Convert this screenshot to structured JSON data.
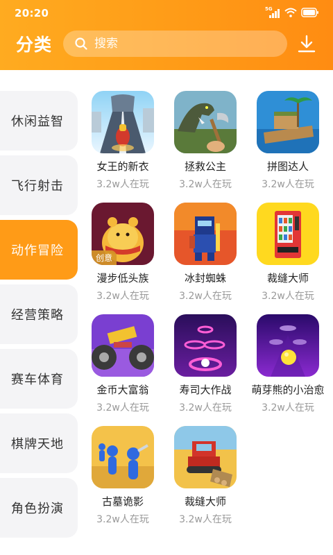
{
  "status": {
    "time": "20:20",
    "network": "5G"
  },
  "header": {
    "title": "分类",
    "search_placeholder": "搜索"
  },
  "sidebar": {
    "items": [
      {
        "label": "休闲益智",
        "active": false
      },
      {
        "label": "飞行射击",
        "active": false
      },
      {
        "label": "动作冒险",
        "active": true
      },
      {
        "label": "经营策略",
        "active": false
      },
      {
        "label": "赛车体育",
        "active": false
      },
      {
        "label": "棋牌天地",
        "active": false
      },
      {
        "label": "角色扮演",
        "active": false
      }
    ]
  },
  "games": [
    {
      "name": "女王的新衣",
      "players": "3.2w人在玩",
      "icon": "motorbike-racing-icon"
    },
    {
      "name": "拯救公主",
      "players": "3.2w人在玩",
      "icon": "dinosaur-axe-icon"
    },
    {
      "name": "拼图达人",
      "players": "3.2w人在玩",
      "icon": "raft-island-icon"
    },
    {
      "name": "漫步低头族",
      "players": "3.2w人在玩",
      "icon": "hamster-icon",
      "tag": "创意"
    },
    {
      "name": "冰封蜘蛛",
      "players": "3.2w人在玩",
      "icon": "pixel-knight-icon"
    },
    {
      "name": "裁缝大师",
      "players": "3.2w人在玩",
      "icon": "vending-machine-icon"
    },
    {
      "name": "金币大富翁",
      "players": "3.2w人在玩",
      "icon": "monster-truck-icon"
    },
    {
      "name": "寿司大作战",
      "players": "3.2w人在玩",
      "icon": "neon-tiles-icon"
    },
    {
      "name": "萌芽熊的小治愈",
      "players": "3.2w人在玩",
      "icon": "neon-ball-icon"
    },
    {
      "name": "古墓诡影",
      "players": "3.2w人在玩",
      "icon": "blue-stickmen-icon"
    },
    {
      "name": "裁缝大师",
      "players": "3.2w人在玩",
      "icon": "bulldozer-icon"
    }
  ],
  "colors": {
    "accent": "#ff9b17",
    "sidebar_bg": "#f4f4f6",
    "muted_text": "#999999"
  }
}
